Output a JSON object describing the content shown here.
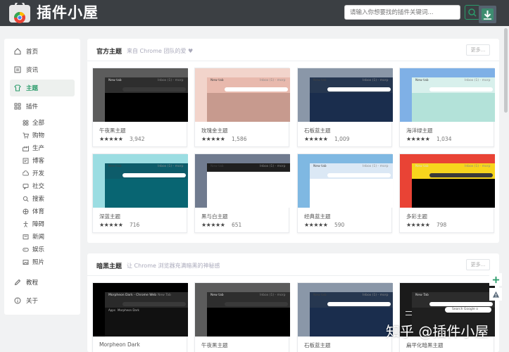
{
  "header": {
    "app_title": "插件小屋",
    "search_placeholder": "请输入你想要找的插件关键词...",
    "search_icon": "search-icon",
    "download_icon": "download-icon"
  },
  "sidebar": {
    "items": [
      {
        "label": "首页",
        "icon": "home-icon"
      },
      {
        "label": "资讯",
        "icon": "news-icon"
      },
      {
        "label": "主题",
        "icon": "theme-icon",
        "active": true
      },
      {
        "label": "插件",
        "icon": "grid-icon"
      }
    ],
    "sub_items": [
      {
        "label": "全部",
        "icon": "all-icon"
      },
      {
        "label": "购物",
        "icon": "cart-icon"
      },
      {
        "label": "生产",
        "icon": "factory-icon"
      },
      {
        "label": "博客",
        "icon": "blog-icon"
      },
      {
        "label": "开发",
        "icon": "cloud-icon"
      },
      {
        "label": "社交",
        "icon": "chat-icon"
      },
      {
        "label": "搜索",
        "icon": "search-icon"
      },
      {
        "label": "体育",
        "icon": "sport-icon"
      },
      {
        "label": "障碍",
        "icon": "accessibility-icon"
      },
      {
        "label": "新闻",
        "icon": "paper-icon"
      },
      {
        "label": "娱乐",
        "icon": "gamepad-icon"
      },
      {
        "label": "照片",
        "icon": "photo-icon"
      }
    ],
    "footer_items": [
      {
        "label": "教程",
        "icon": "pencil-icon"
      },
      {
        "label": "关于",
        "icon": "info-icon"
      }
    ]
  },
  "official_section": {
    "title": "官方主题",
    "subtitle": "来自 Chrome 团队的爱 ♥",
    "more_label": "更多...",
    "cards": [
      {
        "name": "午夜黑主题",
        "rating": "★★★★★",
        "count": "3,942",
        "bg": "#5c5c5c",
        "frame": "#2e2e2e",
        "content": "#000000"
      },
      {
        "name": "玫瑰金主题",
        "rating": "★★★★★",
        "count": "1,586",
        "bg": "#f2d4cb",
        "frame": "#e8b9ad",
        "content": "#c79a8e"
      },
      {
        "name": "石板蓝主题",
        "rating": "★★★★★",
        "count": "1,009",
        "bg": "#8a97a8",
        "frame": "#263750",
        "content": "#1a2d4d"
      },
      {
        "name": "海洋绿主题",
        "rating": "★★★★★",
        "count": "1,034",
        "bg": "#7fb0e6",
        "frame": "#d8f0ec",
        "content": "#b3e2d9"
      },
      {
        "name": "深蓝主题",
        "rating": "★★★★★",
        "count": "716",
        "bg": "#9bdde2",
        "frame": "#0d5c6a",
        "content": "#086572"
      },
      {
        "name": "黑与白主题",
        "rating": "★★★★★",
        "count": "651",
        "bg": "#707b8f",
        "frame": "#1f1f1f",
        "content": "#ffffff"
      },
      {
        "name": "经典蓝主题",
        "rating": "★★★★★",
        "count": "590",
        "bg": "#7fb8e2",
        "frame": "#dbe8f5",
        "content": "#ffffff"
      },
      {
        "name": "多彩主题",
        "rating": "★★★★★",
        "count": "798",
        "bg": "#e94335",
        "frame": "#f7d51d",
        "content": "#000000"
      }
    ]
  },
  "dark_section": {
    "title": "暗黑主题",
    "subtitle": "让 Chrome 浏览器充满暗黑的神秘感",
    "more_label": "更多...",
    "cards": [
      {
        "name": "Morpheon Dark",
        "bg": "#000000",
        "frame": "#2a2a2a",
        "content": "#111111",
        "tab1": "Morpheon Dark - Chrome Web",
        "tab2": "New Tab",
        "apps": "Apps",
        "bookmark": "Morpheon Dark"
      },
      {
        "name": "午夜黑主题",
        "bg": "#5c5c5c",
        "frame": "#2e2e2e",
        "content": "#000000"
      },
      {
        "name": "石板蓝主题",
        "bg": "#8a97a8",
        "frame": "#263750",
        "content": "#1a2d4d"
      },
      {
        "name": "扁平化暗黑主题",
        "bg": "#1a1a1a",
        "frame": "#2c2c2c",
        "content": "#1f1f1f",
        "tab": "New Tab",
        "search_text": "Search Google o"
      }
    ]
  },
  "browser_labels": {
    "new_tab": "New tab",
    "inbox": "Inbox (1) - morp"
  },
  "watermark": "知乎 @插件小屋",
  "fab": {
    "plus_icon": "plus-icon",
    "warning_icon": "warning-icon"
  },
  "colors": {
    "accent": "#2a9b6a",
    "topbar": "#3b3f43"
  }
}
